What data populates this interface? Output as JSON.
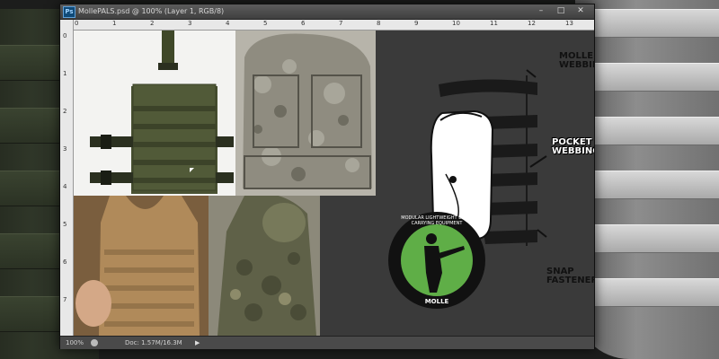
{
  "window": {
    "app_icon": "Ps",
    "title": "MollePALS.psd @ 100% (Layer 1, RGB/8)",
    "min_glyph": "–",
    "max_glyph": "□",
    "close_glyph": "✕"
  },
  "rulers": {
    "horizontal": [
      "0",
      "1",
      "2",
      "3",
      "4",
      "5",
      "6",
      "7",
      "8",
      "9",
      "10",
      "11",
      "12",
      "13"
    ],
    "vertical": [
      "0",
      "1",
      "2",
      "3",
      "4",
      "5",
      "6",
      "7"
    ]
  },
  "diagram": {
    "label_molle_vest_line1": "MOLLE VEST",
    "label_molle_vest_line2": "WEBBING",
    "label_pocket_line1": "POCKET",
    "label_pocket_line2": "WEBBING",
    "label_snap_line1": "SNAP",
    "label_snap_line2": "FASTENER"
  },
  "logo": {
    "ring_text": "MODULAR LIGHTWEIGHT LOAD-CARRYING EQUIPMENT",
    "bottom_text": "MOLLE"
  },
  "status": {
    "zoom": "100%",
    "doc_info": "Doc: 1.57M/16.3M",
    "arrow": "▶"
  },
  "colors": {
    "olive": "#4a5233",
    "tan": "#b08a5a",
    "logo_green": "#5fae47",
    "ui_dark": "#3d3d3d"
  },
  "icons": [
    "photoshop-app-icon",
    "minimize-icon",
    "maximize-icon",
    "close-icon",
    "status-icon",
    "arrow-right-icon",
    "cursor-icon"
  ]
}
